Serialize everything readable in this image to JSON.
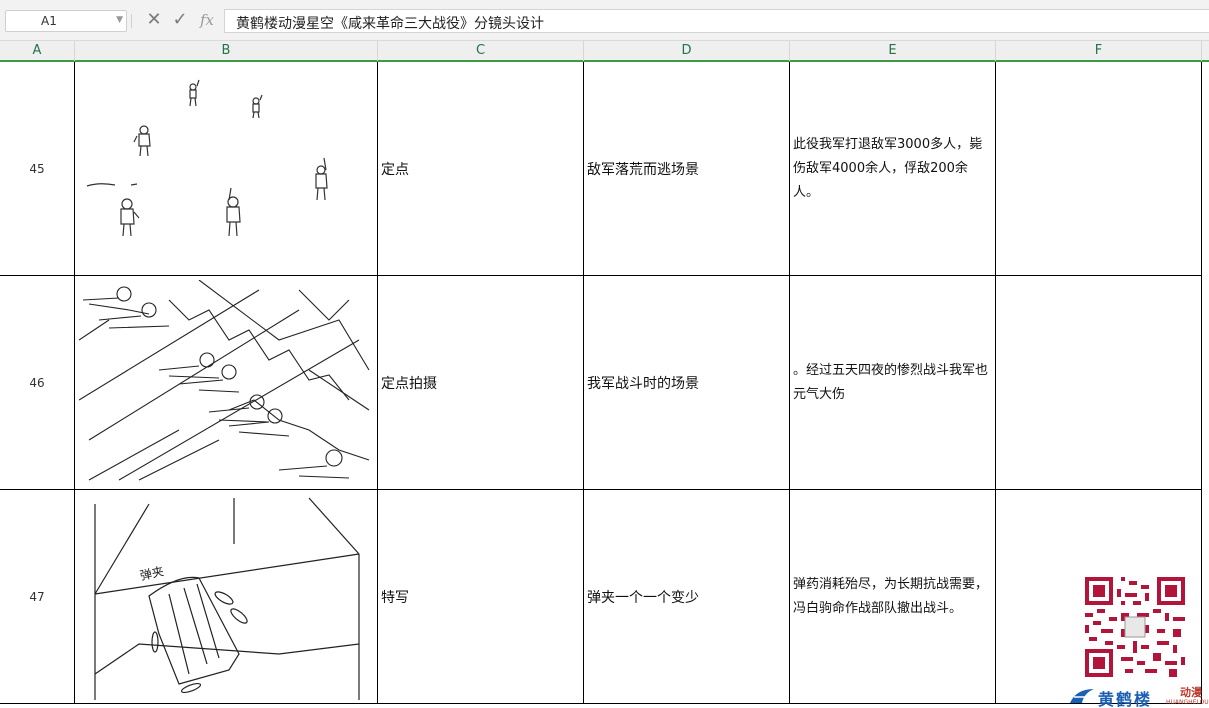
{
  "formula_bar": {
    "cell_reference": "A1",
    "cancel_icon": "close-icon",
    "confirm_icon": "check-icon",
    "fx_label": "fx",
    "content": "黄鹤楼动漫星空《咸来革命三大战役》分镜头设计"
  },
  "columns": [
    "A",
    "B",
    "C",
    "D",
    "E",
    "F"
  ],
  "rows": [
    {
      "row_number": "45",
      "picture": "soldiers-fleeing-sketch",
      "shot_type": "定点",
      "content": "敌军落荒而逃场景",
      "note": "此役我军打退敌军3000多人，毙伤敌军4000余人，俘敌200余人。",
      "extra": ""
    },
    {
      "row_number": "46",
      "picture": "soldiers-battle-sketch",
      "shot_type": "定点拍摄",
      "content": "我军战斗时的场景",
      "note": "。经过五天四夜的惨烈战斗我军也元气大伤",
      "extra": ""
    },
    {
      "row_number": "47",
      "picture": "ammo-clip-sketch",
      "shot_type": "特写",
      "content": "弹夹一个一个变少",
      "note": "弹药消耗殆尽，为长期抗战需要，冯白驹命作战部队撤出战斗。",
      "extra": ""
    }
  ],
  "sketch_labels": {
    "clip_label": "弹夹"
  },
  "watermark": {
    "logo_text": "黄鹤楼",
    "logo_sub": "动漫",
    "logo_small": "HUANGHELOU"
  },
  "colors": {
    "header_accent": "#217346",
    "header_underline": "#3f9a48",
    "logo_blue": "#1a5fb4",
    "logo_red": "#c0392b"
  }
}
